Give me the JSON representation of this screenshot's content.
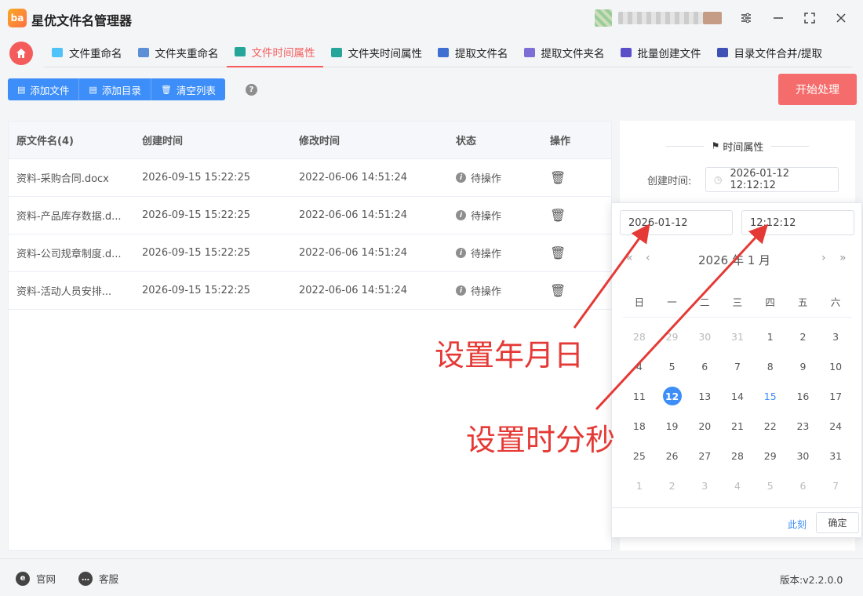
{
  "app": {
    "title": "星优文件名管理器",
    "logo_text": "ba"
  },
  "nav": {
    "tabs": [
      {
        "label": "文件重命名",
        "color": "#4fc3f7"
      },
      {
        "label": "文件夹重命名",
        "color": "#5c8fd6"
      },
      {
        "label": "文件时间属性",
        "color": "#26a69a",
        "active": true
      },
      {
        "label": "文件夹时间属性",
        "color": "#26a69a"
      },
      {
        "label": "提取文件名",
        "color": "#3f6fd1"
      },
      {
        "label": "提取文件夹名",
        "color": "#7e6fd6"
      },
      {
        "label": "批量创建文件",
        "color": "#5b4fc9"
      },
      {
        "label": "目录文件合并/提取",
        "color": "#3f51b5"
      }
    ]
  },
  "toolbar": {
    "add_file": "添加文件",
    "add_dir": "添加目录",
    "clear_list": "清空列表",
    "help": "?",
    "start": "开始处理"
  },
  "table": {
    "headers": [
      "原文件名(4)",
      "创建时间",
      "修改时间",
      "状态",
      "操作"
    ],
    "rows": [
      {
        "name": "资料-采购合同.docx",
        "created": "2026-09-15 15:22:25",
        "modified": "2022-06-06 14:51:24",
        "status": "待操作"
      },
      {
        "name": "资料-产品库存数据.d...",
        "created": "2026-09-15 15:22:25",
        "modified": "2022-06-06 14:51:24",
        "status": "待操作"
      },
      {
        "name": "资料-公司规章制度.d...",
        "created": "2026-09-15 15:22:25",
        "modified": "2022-06-06 14:51:24",
        "status": "待操作"
      },
      {
        "name": "资料-活动人员安排...",
        "created": "2026-09-15 15:22:25",
        "modified": "2022-06-06 14:51:24",
        "status": "待操作"
      }
    ]
  },
  "time_panel": {
    "heading": "时间属性",
    "created_label": "创建时间:",
    "created_value": "2026-01-12 12:12:12"
  },
  "picker": {
    "date_value": "2026-01-12",
    "time_value": "12:12:12",
    "title": "2026 年 1 月",
    "weekdays": [
      "日",
      "一",
      "二",
      "三",
      "四",
      "五",
      "六"
    ],
    "days": [
      [
        "28",
        "muted"
      ],
      [
        "29",
        "muted"
      ],
      [
        "30",
        "muted"
      ],
      [
        "31",
        "muted"
      ],
      [
        "1",
        ""
      ],
      [
        "2",
        ""
      ],
      [
        "3",
        ""
      ],
      [
        "4",
        ""
      ],
      [
        "5",
        ""
      ],
      [
        "6",
        ""
      ],
      [
        "7",
        ""
      ],
      [
        "8",
        ""
      ],
      [
        "9",
        ""
      ],
      [
        "10",
        ""
      ],
      [
        "11",
        ""
      ],
      [
        "12",
        "sel"
      ],
      [
        "13",
        ""
      ],
      [
        "14",
        ""
      ],
      [
        "15",
        "today"
      ],
      [
        "16",
        ""
      ],
      [
        "17",
        ""
      ],
      [
        "18",
        ""
      ],
      [
        "19",
        ""
      ],
      [
        "20",
        ""
      ],
      [
        "21",
        ""
      ],
      [
        "22",
        ""
      ],
      [
        "23",
        ""
      ],
      [
        "24",
        ""
      ],
      [
        "25",
        ""
      ],
      [
        "26",
        ""
      ],
      [
        "27",
        ""
      ],
      [
        "28",
        ""
      ],
      [
        "29",
        ""
      ],
      [
        "30",
        ""
      ],
      [
        "31",
        ""
      ],
      [
        "1",
        "muted"
      ],
      [
        "2",
        "muted"
      ],
      [
        "3",
        "muted"
      ],
      [
        "4",
        "muted"
      ],
      [
        "5",
        "muted"
      ],
      [
        "6",
        "muted"
      ],
      [
        "7",
        "muted"
      ]
    ],
    "now": "此刻",
    "ok": "确定"
  },
  "annotations": {
    "date_hint": "设置年月日",
    "time_hint": "设置时分秒",
    "color": "#e53935"
  },
  "statusbar": {
    "website": "官网",
    "support": "客服",
    "version": "版本:v2.2.0.0"
  }
}
